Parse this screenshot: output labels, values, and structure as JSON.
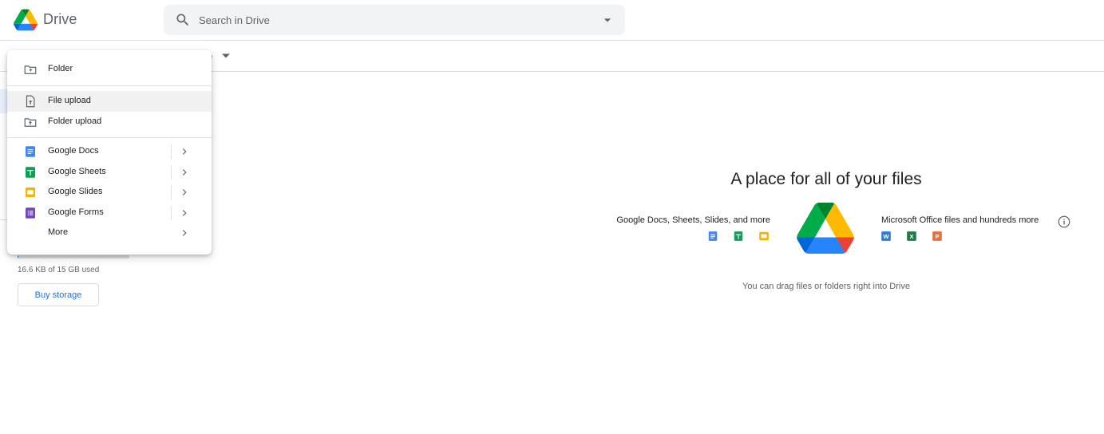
{
  "header": {
    "app_name": "Drive",
    "search": {
      "placeholder": "Search in Drive"
    }
  },
  "toolbar": {
    "partial_label": "e"
  },
  "storage": {
    "used_fraction": 0.001,
    "used_text": "16.6 KB of 15 GB used",
    "buy_label": "Buy storage"
  },
  "new_menu": {
    "items": [
      {
        "label": "Folder",
        "icon": "new-folder-icon"
      },
      {
        "label": "File upload",
        "icon": "file-upload-icon",
        "hovered": true
      },
      {
        "label": "Folder upload",
        "icon": "folder-upload-icon"
      },
      {
        "label": "Google Docs",
        "icon": "google-docs-icon",
        "submenu": true
      },
      {
        "label": "Google Sheets",
        "icon": "google-sheets-icon",
        "submenu": true
      },
      {
        "label": "Google Slides",
        "icon": "google-slides-icon",
        "submenu": true
      },
      {
        "label": "Google Forms",
        "icon": "google-forms-icon",
        "submenu": true
      },
      {
        "label": "More",
        "icon": "",
        "submenu": true
      }
    ]
  },
  "empty_state": {
    "title": "A place for all of your files",
    "left_caption": "Google Docs, Sheets, Slides, and more",
    "right_caption": "Microsoft Office files and hundreds more",
    "drag_hint": "You can drag files or folders right into Drive",
    "office_letters": {
      "word": "W",
      "excel": "X",
      "powerpoint": "P"
    }
  },
  "colors": {
    "docs": "#4285f4",
    "sheets": "#0f9d58",
    "slides": "#f4b400",
    "forms": "#7248b9",
    "word": "#2b7cd3",
    "excel": "#1e7e45",
    "powerpoint": "#e8703a",
    "accent": "#1a73e8"
  }
}
